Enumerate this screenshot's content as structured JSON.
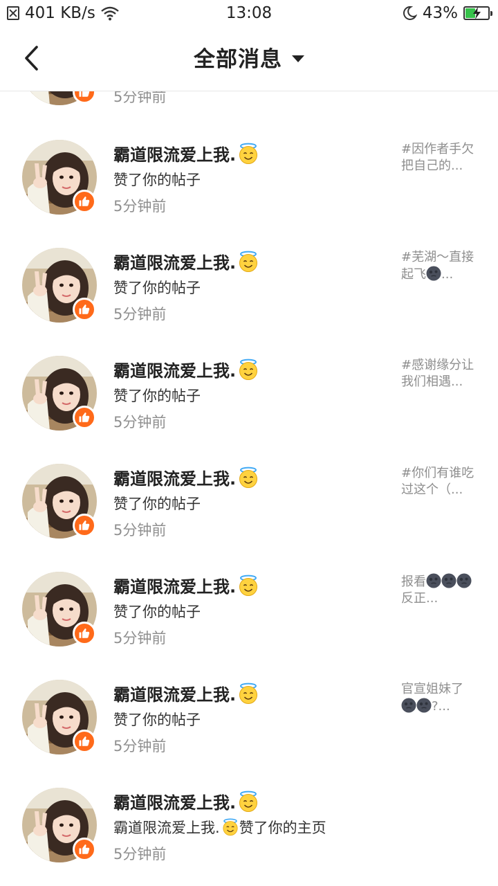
{
  "status_bar": {
    "speed": "401 KB/s",
    "time": "13:08",
    "battery": "43%",
    "battery_level": 0.43
  },
  "header": {
    "title": "全部消息"
  },
  "partial_row": {
    "time": "5分钟前"
  },
  "rows": [
    {
      "name": "霸道限流爱上我.",
      "action": "赞了你的帖子",
      "time": "5分钟前",
      "preview": "#因作者手欠把自己的..."
    },
    {
      "name": "霸道限流爱上我.",
      "action": "赞了你的帖子",
      "time": "5分钟前",
      "preview_a": "#芜湖～直接起飞",
      "preview_b": "..."
    },
    {
      "name": "霸道限流爱上我.",
      "action": "赞了你的帖子",
      "time": "5分钟前",
      "preview": "#感谢缘分让我们相遇..."
    },
    {
      "name": "霸道限流爱上我.",
      "action": "赞了你的帖子",
      "time": "5分钟前",
      "preview": "#你们有谁吃过这个（..."
    },
    {
      "name": "霸道限流爱上我.",
      "action": "赞了你的帖子",
      "time": "5分钟前",
      "preview_a": "报看",
      "preview_b": "反正..."
    },
    {
      "name": "霸道限流爱上我.",
      "action": "赞了你的帖子",
      "time": "5分钟前",
      "preview_a": "官宣姐妹了",
      "preview_b": "?..."
    },
    {
      "name": "霸道限流爱上我.",
      "action_a": "霸道限流爱上我.",
      "action_b": "赞了你的主页",
      "time": "5分钟前"
    }
  ],
  "icons": {
    "back": "chevron-left-icon",
    "dropdown": "caret-down-icon",
    "like": "thumbs-up-icon",
    "halo": "smiling-face-with-halo-icon",
    "moon": "new-moon-face-icon"
  },
  "colors": {
    "like_badge": "#ff6a1a",
    "battery": "#36c24a",
    "muted_text": "#8f8f8f"
  }
}
